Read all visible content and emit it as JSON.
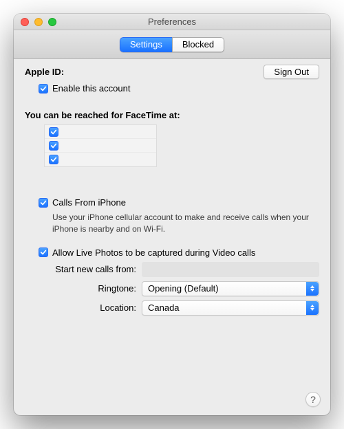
{
  "window": {
    "title": "Preferences"
  },
  "tabs": {
    "settings": "Settings",
    "blocked": "Blocked",
    "active": "settings"
  },
  "appleId": {
    "label": "Apple ID:",
    "signOut": "Sign Out"
  },
  "enable": {
    "label": "Enable this account",
    "checked": true
  },
  "reach": {
    "heading": "You can be reached for FaceTime at:",
    "items": [
      {
        "checked": true
      },
      {
        "checked": true
      },
      {
        "checked": true
      }
    ]
  },
  "callsFromIphone": {
    "label": "Calls From iPhone",
    "checked": true,
    "description": "Use your iPhone cellular account to make and receive calls when your iPhone is nearby and on Wi-Fi."
  },
  "livePhotos": {
    "label": "Allow Live Photos to be captured during Video calls",
    "checked": true
  },
  "startFrom": {
    "label": "Start new calls from:",
    "value": ""
  },
  "ringtone": {
    "label": "Ringtone:",
    "value": "Opening (Default)"
  },
  "location": {
    "label": "Location:",
    "value": "Canada"
  },
  "help": "?"
}
